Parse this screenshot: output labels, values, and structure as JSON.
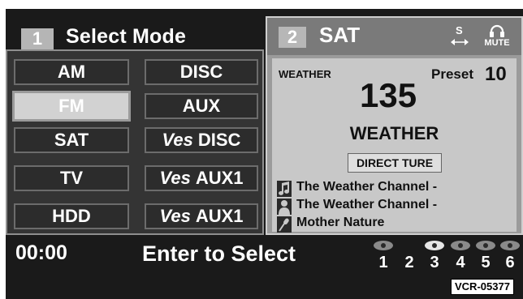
{
  "left": {
    "number": "1",
    "title": "Select Mode",
    "modes": [
      {
        "prefix": "",
        "label": "AM"
      },
      {
        "prefix": "",
        "label": "DISC"
      },
      {
        "prefix": "",
        "label": "FM"
      },
      {
        "prefix": "",
        "label": "AUX"
      },
      {
        "prefix": "",
        "label": "SAT"
      },
      {
        "prefix": "Ves",
        "label": "DISC"
      },
      {
        "prefix": "",
        "label": "TV"
      },
      {
        "prefix": "Ves",
        "label": "AUX1"
      },
      {
        "prefix": "",
        "label": "HDD"
      },
      {
        "prefix": "Ves",
        "label": "AUX1"
      }
    ],
    "selected_mode": "FM"
  },
  "right": {
    "number": "2",
    "title": "SAT",
    "scan_icon_letter": "S",
    "mute_label": "MUTE",
    "channel_name": "WEATHER",
    "preset_label": "Preset",
    "preset_value": "10",
    "channel_number": "135",
    "category": "WEATHER",
    "direct_button": "DIRECT TURE",
    "info": [
      {
        "icon": "music-note-icon",
        "text": "The Weather Channel -"
      },
      {
        "icon": "artist-icon",
        "text": "The Weather Channel -"
      },
      {
        "icon": "microphone-icon",
        "text": "Mother Nature"
      }
    ]
  },
  "bottom": {
    "time": "00:00",
    "prompt": "Enter to Select",
    "discs": [
      "1",
      "2",
      "3",
      "4",
      "5",
      "6"
    ],
    "active_disc": "3"
  },
  "ref_code": "VCR-05377"
}
